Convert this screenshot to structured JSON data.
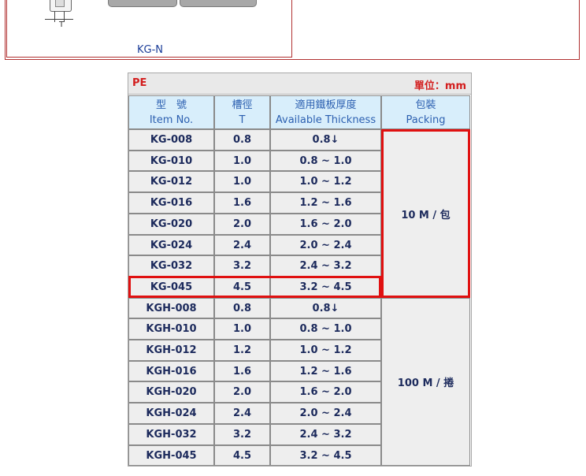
{
  "top_panel": {
    "caption": "KG-N",
    "dim_label": "T"
  },
  "spec_table": {
    "material": "PE",
    "unit": "單位：mm",
    "headers": {
      "item": {
        "zh": "型　號",
        "en": "Item No."
      },
      "groove": {
        "zh": "槽徑",
        "en": "T"
      },
      "thickness": {
        "zh": "適用鐵板厚度",
        "en": "Available Thickness"
      },
      "packing": {
        "zh": "包裝",
        "en": "Packing"
      }
    },
    "rows": [
      {
        "item": "KG-008",
        "groove": "0.8",
        "thickness": "0.8↓"
      },
      {
        "item": "KG-010",
        "groove": "1.0",
        "thickness": "0.8 ~ 1.0"
      },
      {
        "item": "KG-012",
        "groove": "1.0",
        "thickness": "1.0 ~ 1.2"
      },
      {
        "item": "KG-016",
        "groove": "1.6",
        "thickness": "1.2 ~ 1.6"
      },
      {
        "item": "KG-020",
        "groove": "2.0",
        "thickness": "1.6 ~ 2.0"
      },
      {
        "item": "KG-024",
        "groove": "2.4",
        "thickness": "2.0 ~ 2.4"
      },
      {
        "item": "KG-032",
        "groove": "3.2",
        "thickness": "2.4 ~ 3.2"
      },
      {
        "item": "KG-045",
        "groove": "4.5",
        "thickness": "3.2 ~ 4.5"
      },
      {
        "item": "KGH-008",
        "groove": "0.8",
        "thickness": "0.8↓"
      },
      {
        "item": "KGH-010",
        "groove": "1.0",
        "thickness": "0.8 ~ 1.0"
      },
      {
        "item": "KGH-012",
        "groove": "1.2",
        "thickness": "1.0 ~ 1.2"
      },
      {
        "item": "KGH-016",
        "groove": "1.6",
        "thickness": "1.2 ~ 1.6"
      },
      {
        "item": "KGH-020",
        "groove": "2.0",
        "thickness": "1.6 ~ 2.0"
      },
      {
        "item": "KGH-024",
        "groove": "2.4",
        "thickness": "2.0 ~ 2.4"
      },
      {
        "item": "KGH-032",
        "groove": "3.2",
        "thickness": "2.4 ~ 3.2"
      },
      {
        "item": "KGH-045",
        "groove": "4.5",
        "thickness": "3.2 ~ 4.5"
      }
    ],
    "packing_groups": [
      {
        "label": "10 M / 包",
        "rows": 8
      },
      {
        "label": "100 M / 捲",
        "rows": 8
      }
    ],
    "highlight_row": "KG-045",
    "highlight_packing": "10 M / 包",
    "highlight_color": "#e01010"
  }
}
